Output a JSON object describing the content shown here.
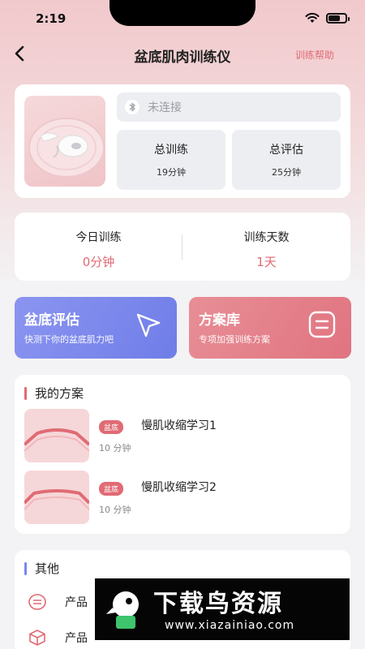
{
  "status": {
    "time": "2:19"
  },
  "nav": {
    "title": "盆底肌肉训练仪",
    "help": "训练帮助"
  },
  "device": {
    "connection": "未连接",
    "total_training_label": "总训练",
    "total_training_value": "19分钟",
    "total_eval_label": "总评估",
    "total_eval_value": "25分钟"
  },
  "today": {
    "training_label": "今日训练",
    "training_value": "0分钟",
    "days_label": "训练天数",
    "days_value": "1天"
  },
  "actions": {
    "eval_title": "盆底评估",
    "eval_sub": "快测下你的盆底肌力吧",
    "plan_title": "方案库",
    "plan_sub": "专项加强训练方案"
  },
  "my_plans": {
    "title": "我的方案",
    "items": [
      {
        "tag": "盆底",
        "name": "慢肌收缩学习1",
        "duration": "10 分钟"
      },
      {
        "tag": "盆底",
        "name": "慢肌收缩学习2",
        "duration": "10 分钟"
      }
    ]
  },
  "other": {
    "title": "其他",
    "items": [
      {
        "label": "产品"
      },
      {
        "label": "产品"
      }
    ]
  },
  "watermark": {
    "title": "下载鸟资源",
    "url": "www.xiazainiao.com"
  },
  "colors": {
    "accent": "#e06b74",
    "eval": "#7a86ee",
    "plan": "#e47f89"
  }
}
